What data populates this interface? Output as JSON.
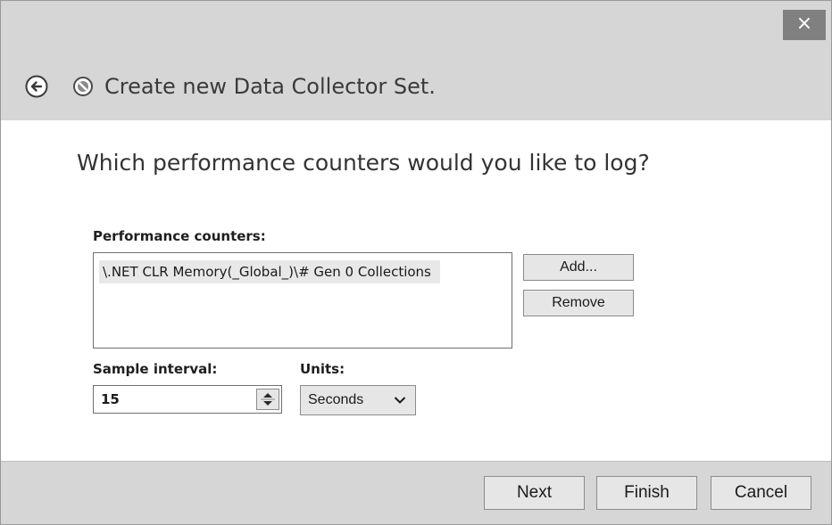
{
  "window": {
    "title": "Create new Data Collector Set.",
    "close_label": "×",
    "icons": {
      "back": "back-arrow-icon",
      "app": "performance-monitor-icon",
      "close": "close-icon"
    }
  },
  "page": {
    "heading": "Which performance counters would you like to log?"
  },
  "counters": {
    "label": "Performance counters:",
    "items": [
      "\\.NET CLR Memory(_Global_)\\# Gen 0 Collections"
    ],
    "add_label": "Add...",
    "remove_label": "Remove"
  },
  "sample": {
    "label": "Sample interval:",
    "value": "15"
  },
  "units": {
    "label": "Units:",
    "selected": "Seconds"
  },
  "footer": {
    "next_label": "Next",
    "finish_label": "Finish",
    "cancel_label": "Cancel"
  }
}
